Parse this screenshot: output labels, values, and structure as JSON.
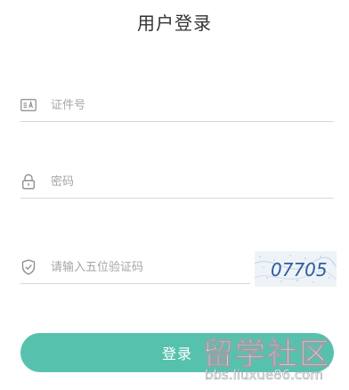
{
  "header": {
    "title": "用户登录"
  },
  "form": {
    "id_field": {
      "icon": "id-card-icon",
      "placeholder": "证件号",
      "value": ""
    },
    "password_field": {
      "icon": "lock-icon",
      "placeholder": "密码",
      "value": ""
    },
    "captcha_field": {
      "icon": "shield-check-icon",
      "placeholder": "请输入五位验证码",
      "value": ""
    },
    "captcha_image": {
      "code": "07705"
    },
    "login_button": {
      "label": "登录"
    }
  },
  "watermark": {
    "main": "留学社区",
    "sub": "bbs.liuxue86.com"
  },
  "colors": {
    "accent": "#56c2ae",
    "icon": "#8a8a8a",
    "divider": "#d8d8d8",
    "placeholder": "#a6a6a6",
    "captcha_text": "#2f5d9e"
  }
}
